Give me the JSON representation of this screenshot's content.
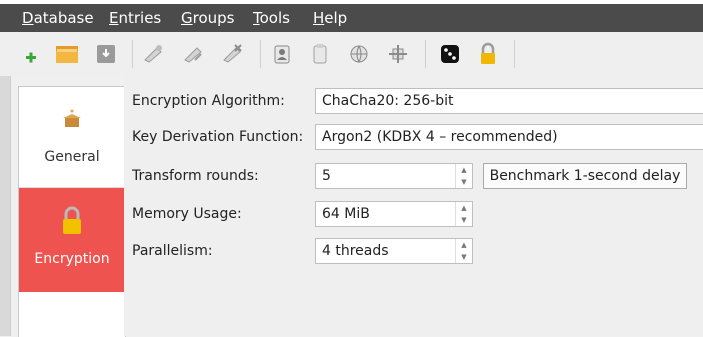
{
  "menu": {
    "database": "Database",
    "entries": "Entries",
    "groups": "Groups",
    "tools": "Tools",
    "help": "Help"
  },
  "toolbar": {
    "icons": [
      "new-database-icon",
      "open-database-icon",
      "save-database-icon",
      "add-entry-icon",
      "edit-entry-icon",
      "delete-entry-icon",
      "copy-username-icon",
      "copy-password-icon",
      "copy-url-icon",
      "settings-icon",
      "dice-icon",
      "lock-icon"
    ]
  },
  "sidebar": {
    "general": "General",
    "encryption": "Encryption",
    "active": "Encryption",
    "active_color": "#ef5350"
  },
  "form": {
    "algorithm_label": "Encryption Algorithm:",
    "algorithm_value": "ChaCha20: 256-bit",
    "kdf_label": "Key Derivation Function:",
    "kdf_value": "Argon2 (KDBX 4 – recommended)",
    "rounds_label": "Transform rounds:",
    "rounds_value": "5",
    "benchmark_label": "Benchmark 1-second delay",
    "memory_label": "Memory Usage:",
    "memory_value": "64 MiB",
    "parallelism_label": "Parallelism:",
    "parallelism_value": "4 threads"
  }
}
